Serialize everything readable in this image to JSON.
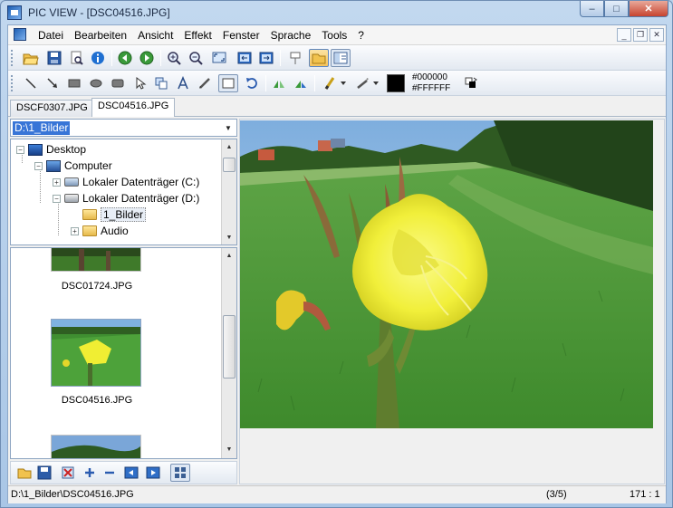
{
  "window": {
    "title": "PIC VIEW  - [DSC04516.JPG]",
    "buttons": {
      "minimize": "–",
      "maximize": "□",
      "close": "✕"
    }
  },
  "menu": {
    "items": [
      {
        "label": "Datei"
      },
      {
        "label": "Bearbeiten"
      },
      {
        "label": "Ansicht"
      },
      {
        "label": "Effekt"
      },
      {
        "label": "Fenster"
      },
      {
        "label": "Sprache"
      },
      {
        "label": "Tools"
      },
      {
        "label": "?"
      }
    ],
    "mdi": {
      "minimize": "_",
      "restore": "❐",
      "close": "✕"
    }
  },
  "toolbar1": {
    "buttons": [
      "open-folder",
      "save",
      "print-preview",
      "info",
      "back",
      "forward",
      "zoom-in",
      "zoom-out",
      "fit-screen",
      "fit-window-1",
      "fit-window-2",
      "pin",
      "browser",
      "explorer-view"
    ]
  },
  "toolbar2": {
    "buttons": [
      "line",
      "arrow",
      "rectangle",
      "ellipse",
      "filled-rect",
      "pointer",
      "text-cursor",
      "text",
      "pen",
      "select-rect",
      "undo",
      "mirror",
      "flip",
      "brush",
      "brush-arrow",
      "paint",
      "paint-arrow"
    ],
    "color_fg": "#000000",
    "color_bg": "#FFFFFF",
    "swatch": "#000000"
  },
  "tabs": [
    {
      "label": "DSCF0307.JPG",
      "selected": false
    },
    {
      "label": "DSC04516.JPG",
      "selected": true
    }
  ],
  "path_combo": {
    "value": "D:\\1_Bilder"
  },
  "tree": [
    {
      "label": "Desktop"
    },
    {
      "label": "Computer"
    },
    {
      "label": "Lokaler Datenträger (C:)"
    },
    {
      "label": "Lokaler Datenträger (D:)"
    },
    {
      "label": "1_Bilder"
    },
    {
      "label": "Audio"
    }
  ],
  "thumbnails": [
    {
      "label": "DSC01724.JPG"
    },
    {
      "label": "DSC04516.JPG"
    }
  ],
  "status": {
    "path": "D:\\1_Bilder\\DSC04516.JPG",
    "count": "(3/5)",
    "zoom": "171 : 1"
  }
}
